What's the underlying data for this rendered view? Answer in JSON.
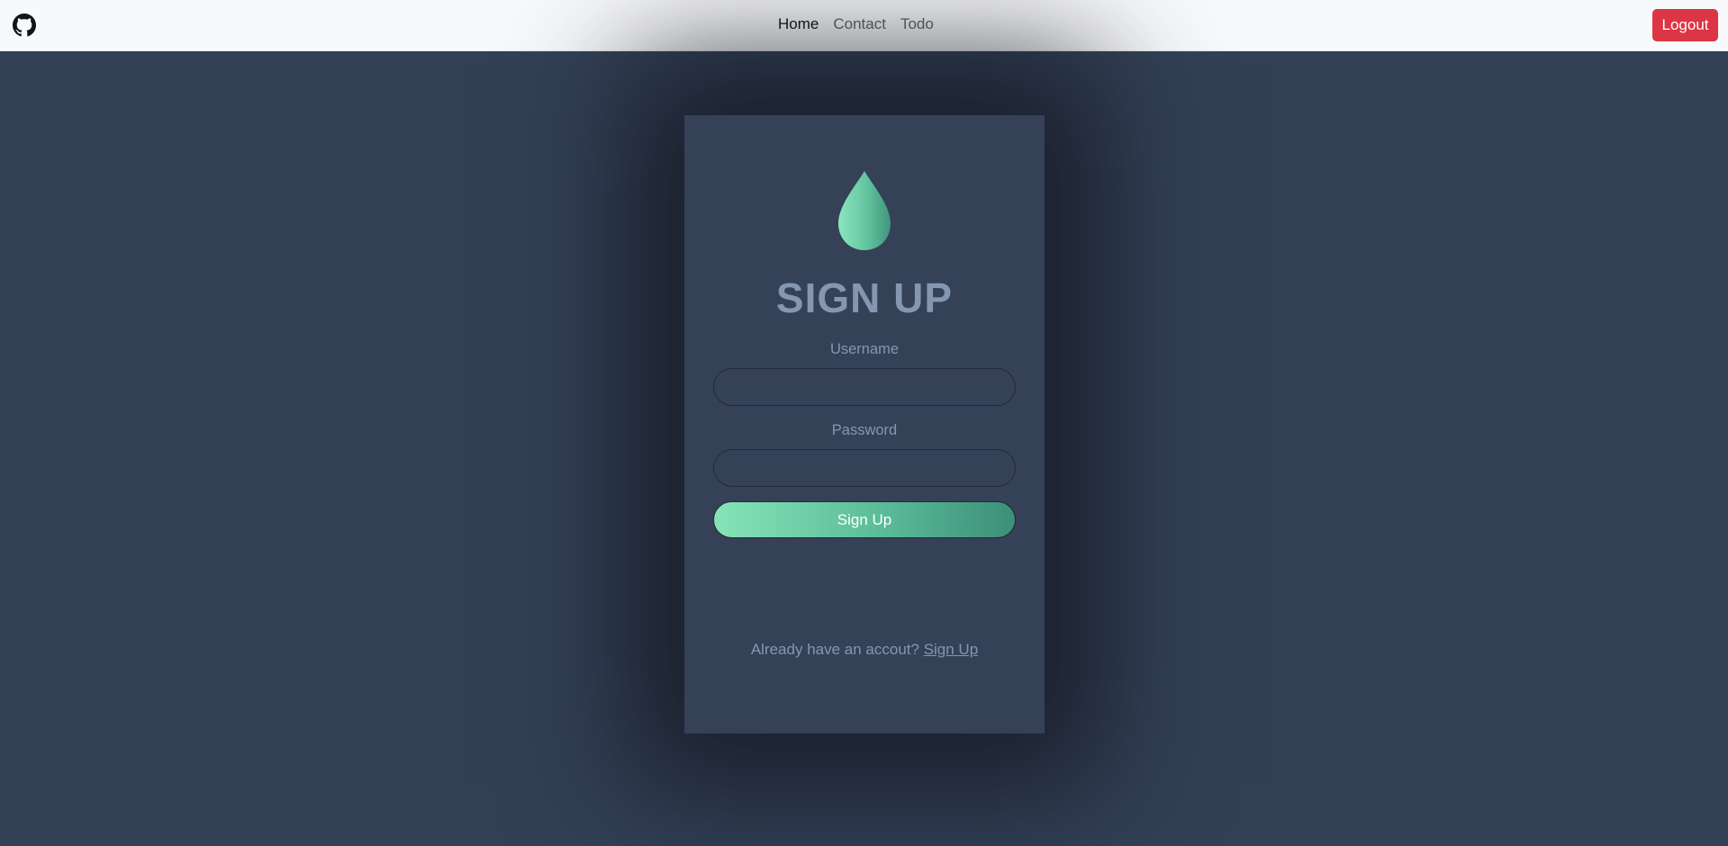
{
  "navbar": {
    "logo_icon": "github-icon",
    "links": [
      {
        "label": "Home",
        "active": true
      },
      {
        "label": "Contact",
        "active": false
      },
      {
        "label": "Todo",
        "active": false
      }
    ],
    "logout_label": "Logout"
  },
  "form": {
    "logo_icon": "water-drop-icon",
    "title": "SIGN UP",
    "username_label": "Username",
    "username_value": "",
    "password_label": "Password",
    "password_value": "",
    "submit_label": "Sign Up",
    "footer_text": "Already have an accout?",
    "footer_link": "Sign Up"
  },
  "colors": {
    "page_background": "#334056",
    "card_background": "#344157",
    "navbar_background": "#f8f9fa",
    "muted_text": "#8596b0",
    "danger": "#dc3545",
    "accent_gradient_start": "#87e3b7",
    "accent_gradient_end": "#3c8f78"
  }
}
